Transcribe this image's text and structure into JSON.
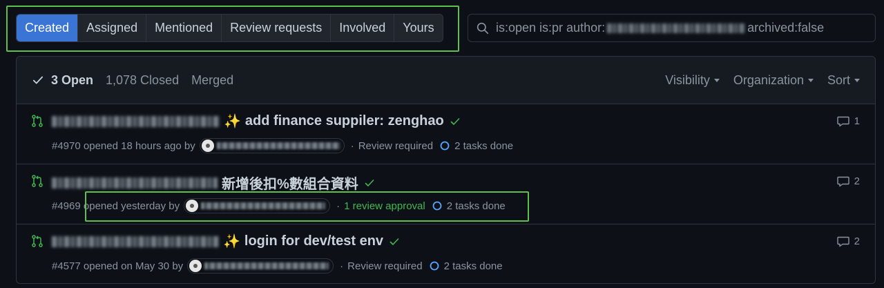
{
  "tabs": [
    {
      "label": "Created",
      "active": true
    },
    {
      "label": "Assigned",
      "active": false
    },
    {
      "label": "Mentioned",
      "active": false
    },
    {
      "label": "Review requests",
      "active": false
    },
    {
      "label": "Involved",
      "active": false
    },
    {
      "label": "Yours",
      "active": false
    }
  ],
  "search": {
    "prefix": "is:open is:pr author:",
    "suffix": "archived:false"
  },
  "states": {
    "open_label": "3 Open",
    "closed_label": "1,078 Closed",
    "merged_label": "Merged"
  },
  "filters": {
    "visibility": "Visibility",
    "organization": "Organization",
    "sort": "Sort"
  },
  "pull_requests": [
    {
      "title": "add finance suppiler: zenghao",
      "emoji": "✨",
      "number": "#4970",
      "opened": "opened 18 hours ago by",
      "status": "Review required",
      "tasks": "2 tasks done",
      "comments": "1"
    },
    {
      "title": "新增後扣%數組合資料",
      "emoji": "",
      "number": "#4969",
      "opened": "opened yesterday by",
      "status": "1 review approval",
      "tasks": "2 tasks done",
      "comments": "2"
    },
    {
      "title": "login for dev/test env",
      "emoji": "✨",
      "number": "#4577",
      "opened": "opened on May 30 by",
      "status": "Review required",
      "tasks": "2 tasks done",
      "comments": "2"
    }
  ],
  "colors": {
    "accent": "#3a74d4",
    "open_green": "#3fb950",
    "highlight": "#5fbf4f",
    "background": "#0d1117"
  },
  "icons": {
    "search": "search-icon",
    "check": "check-icon",
    "pull_request": "git-pull-request-icon",
    "comment": "comment-icon",
    "tasks": "progress-circle-icon"
  }
}
